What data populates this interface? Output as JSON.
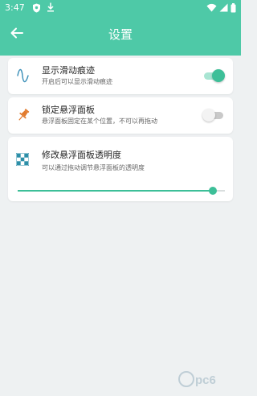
{
  "status_bar": {
    "time": "3:47",
    "icons": [
      "shield-icon",
      "download-icon",
      "wifi-icon",
      "signal-icon",
      "battery-icon"
    ]
  },
  "toolbar": {
    "title": "设置",
    "back_icon": "arrow-left-icon"
  },
  "settings": [
    {
      "title": "显示滑动痕迹",
      "description": "开启后可以显示滑动痕迹",
      "icon": "wave-icon",
      "toggle_on": true
    },
    {
      "title": "锁定悬浮面板",
      "description": "悬浮面板固定在某个位置，不可以再拖动",
      "icon": "pin-icon",
      "toggle_on": false
    },
    {
      "title": "修改悬浮面板透明度",
      "description": "可以通过拖动调节悬浮面板的透明度",
      "icon": "transparency-checker-icon",
      "slider_value": 0.94
    }
  ],
  "colors": {
    "accent": "#4ec9a7",
    "switch_on": "#3dbf98",
    "pin_icon": "#e27b2e",
    "background": "#eef1f2"
  }
}
